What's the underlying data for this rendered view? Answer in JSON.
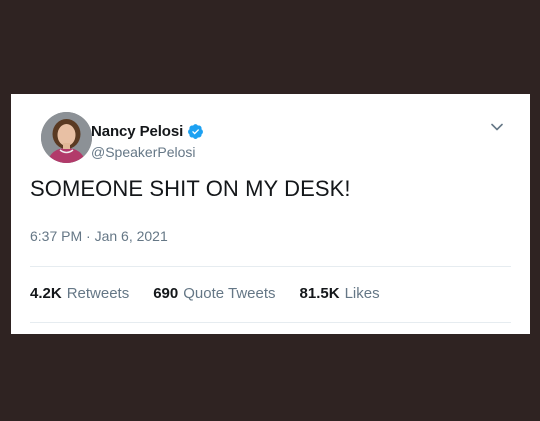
{
  "tweet": {
    "author": {
      "display_name": "Nancy Pelosi",
      "handle": "@SpeakerPelosi",
      "verified": true
    },
    "text": "SOMEONE SHIT ON MY DESK!",
    "timestamp": "6:37 PM · Jan 6, 2021",
    "stats": [
      {
        "count": "4.2K",
        "label": "Retweets"
      },
      {
        "count": "690",
        "label": "Quote Tweets"
      },
      {
        "count": "81.5K",
        "label": "Likes"
      }
    ]
  },
  "colors": {
    "background": "#2f2322",
    "card": "#ffffff",
    "verified_blue": "#1da1f2",
    "secondary_text": "#657786",
    "primary_text": "#14171a"
  },
  "icons": {
    "verified": "verified-badge-icon",
    "more": "chevron-down-icon",
    "avatar": "avatar"
  }
}
